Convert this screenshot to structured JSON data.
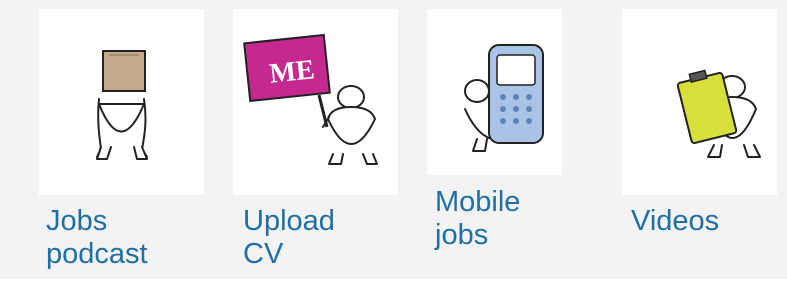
{
  "tiles": [
    {
      "label_lines": [
        "Jobs",
        "podcast"
      ],
      "icon": "figure-holding-box-icon"
    },
    {
      "label_lines": [
        "Upload",
        "CV"
      ],
      "icon": "figure-holding-me-sign-icon",
      "sign_text": "ME"
    },
    {
      "label_lines": [
        "Mobile",
        "jobs"
      ],
      "icon": "figure-holding-mobile-phone-icon"
    },
    {
      "label_lines": [
        "Videos"
      ],
      "icon": "figure-holding-clipboard-icon"
    }
  ],
  "colors": {
    "link": "#1f6fa6",
    "panel_bg": "#f3f3f3",
    "sign_magenta": "#c5288f",
    "box_tan": "#c4a98a",
    "phone_blue": "#a9c3e6",
    "clipboard_yellow": "#d7df3a"
  }
}
